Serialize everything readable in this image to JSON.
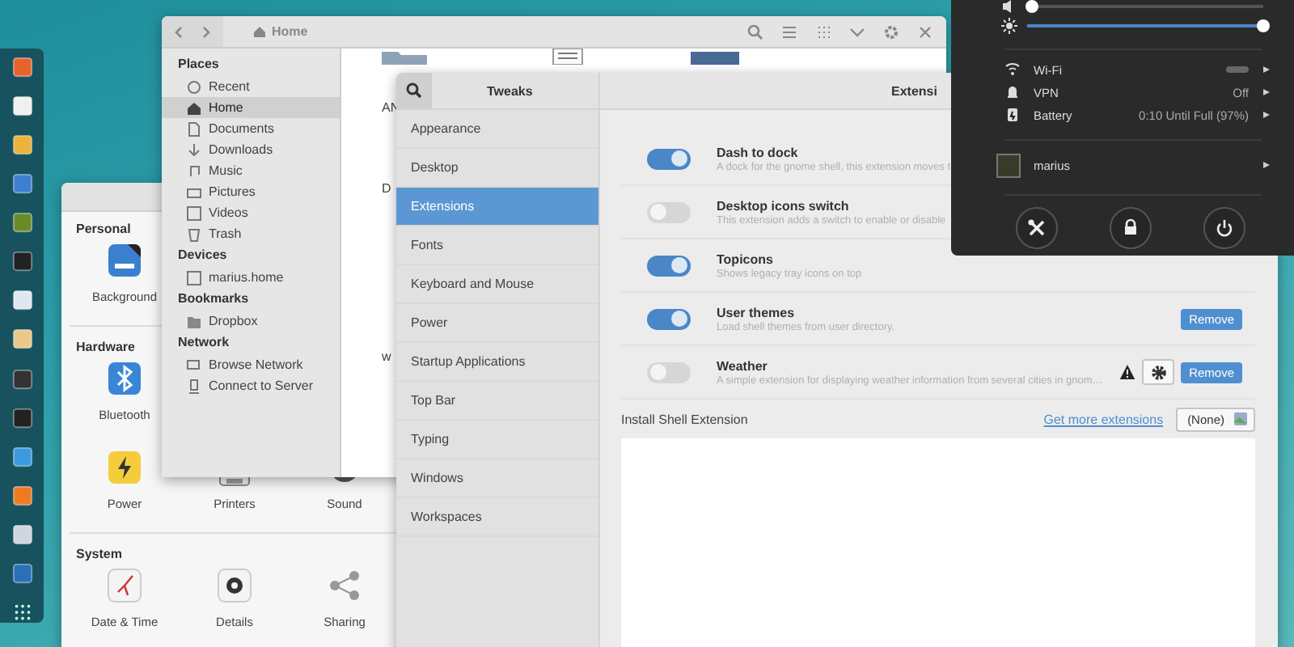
{
  "settings_window": {
    "sections": [
      {
        "title": "Personal",
        "rows": [
          {
            "items": [
              {
                "label": "Background"
              }
            ]
          }
        ]
      },
      {
        "title": "Hardware",
        "rows": [
          {
            "items": [
              {
                "label": "Bluetooth"
              }
            ]
          },
          {
            "items": [
              {
                "label": "Power"
              },
              {
                "label": "Printers"
              },
              {
                "label": "Sound"
              }
            ]
          }
        ]
      },
      {
        "title": "System",
        "rows": [
          {
            "items": [
              {
                "label": "Date & Time"
              },
              {
                "label": "Details"
              },
              {
                "label": "Sharing"
              }
            ]
          }
        ]
      }
    ]
  },
  "files_window": {
    "title": "Home",
    "sidebar": [
      {
        "heading": "Places",
        "items": [
          {
            "label": "Recent",
            "selected": false
          },
          {
            "label": "Home",
            "selected": true
          },
          {
            "label": "Documents",
            "selected": false
          },
          {
            "label": "Downloads",
            "selected": false
          },
          {
            "label": "Music",
            "selected": false
          },
          {
            "label": "Pictures",
            "selected": false
          },
          {
            "label": "Videos",
            "selected": false
          },
          {
            "label": "Trash",
            "selected": false
          }
        ]
      },
      {
        "heading": "Devices",
        "items": [
          {
            "label": "marius.home",
            "selected": false
          }
        ]
      },
      {
        "heading": "Bookmarks",
        "items": [
          {
            "label": "Dropbox",
            "selected": false
          }
        ]
      },
      {
        "heading": "Network",
        "items": [
          {
            "label": "Browse Network",
            "selected": false
          },
          {
            "label": "Connect to Server",
            "selected": false
          }
        ]
      }
    ],
    "file_labels": [
      "AN",
      "D",
      "w"
    ]
  },
  "tweaks_window": {
    "title": "Tweaks",
    "page_title": "Extensi",
    "sidebar": [
      {
        "label": "Appearance",
        "selected": false
      },
      {
        "label": "Desktop",
        "selected": false
      },
      {
        "label": "Extensions",
        "selected": true
      },
      {
        "label": "Fonts",
        "selected": false
      },
      {
        "label": "Keyboard and Mouse",
        "selected": false
      },
      {
        "label": "Power",
        "selected": false
      },
      {
        "label": "Startup Applications",
        "selected": false
      },
      {
        "label": "Top Bar",
        "selected": false
      },
      {
        "label": "Typing",
        "selected": false
      },
      {
        "label": "Windows",
        "selected": false
      },
      {
        "label": "Workspaces",
        "selected": false
      }
    ],
    "extensions": [
      {
        "name": "Dash to dock",
        "description": "A dock for the gnome shell, this extension moves t",
        "on": true,
        "warning": false,
        "settings": false
      },
      {
        "name": "Desktop icons switch",
        "description": "This extension adds a switch to enable or disable",
        "on": false,
        "warning": false,
        "settings": false
      },
      {
        "name": "Topicons",
        "description": "Shows legacy tray icons on top",
        "on": true,
        "warning": false,
        "settings": false
      },
      {
        "name": "User themes",
        "description": "Load shell themes from user directory.",
        "on": true,
        "warning": false,
        "settings": false,
        "remove": "Remove"
      },
      {
        "name": "Weather",
        "description": "A simple extension for displaying weather information from several cities in gnom…",
        "on": false,
        "warning": true,
        "settings": true,
        "remove": "Remove"
      }
    ],
    "install": {
      "label": "Install Shell Extension",
      "link": "Get more extensions",
      "file_button": "(None)"
    }
  },
  "system_menu": {
    "sliders": [
      {
        "level": 0.02
      },
      {
        "level": 1.0
      }
    ],
    "rows": [
      {
        "label": "Wi-Fi"
      },
      {
        "label": "VPN",
        "value": "Off"
      },
      {
        "label": "Battery",
        "value": "0:10 Until Full (97%)"
      }
    ],
    "user": {
      "name": "marius"
    }
  }
}
